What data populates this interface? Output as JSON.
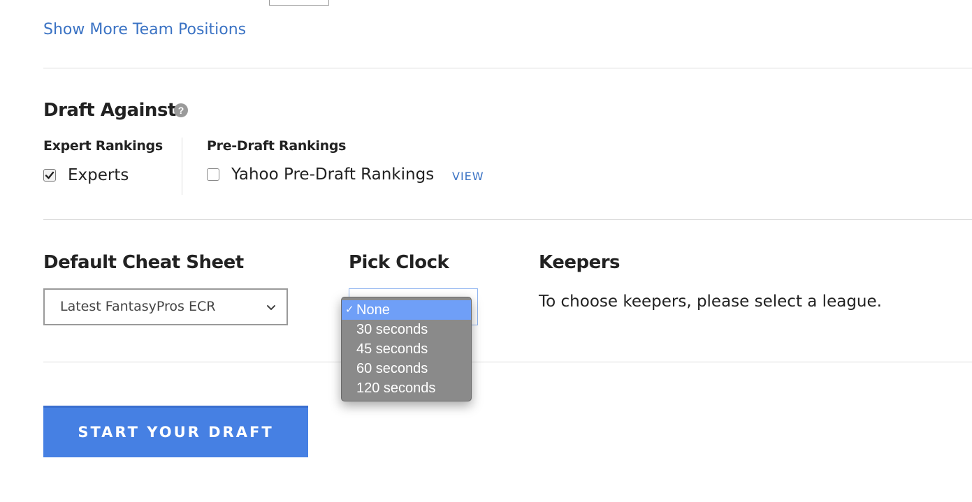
{
  "team_positions": {
    "show_more_label": "Show More Team Positions"
  },
  "draft_against": {
    "title": "Draft Against",
    "help_icon": "question-circle-icon",
    "expert_rankings": {
      "heading": "Expert Rankings",
      "option_label": "Experts",
      "checked": true
    },
    "pre_draft_rankings": {
      "heading": "Pre-Draft Rankings",
      "option_label": "Yahoo Pre-Draft Rankings",
      "checked": false,
      "view_label": "VIEW"
    }
  },
  "cheat_sheet": {
    "title": "Default Cheat Sheet",
    "selected": "Latest FantasyPros ECR",
    "dropdown_icon": "chevron-down-icon"
  },
  "pick_clock": {
    "title": "Pick Clock",
    "check_mark": "✓",
    "options": [
      "None",
      "30 seconds",
      "45 seconds",
      "60 seconds",
      "120 seconds"
    ],
    "selected_index": 0
  },
  "keepers": {
    "title": "Keepers",
    "message": "To choose keepers, please select a league."
  },
  "actions": {
    "start_label": "START YOUR DRAFT"
  },
  "colors": {
    "accent": "#4680e3",
    "link": "#3b73c4",
    "dropdown_bg": "#8a8a8a",
    "dropdown_selected": "#6f9ff7"
  }
}
